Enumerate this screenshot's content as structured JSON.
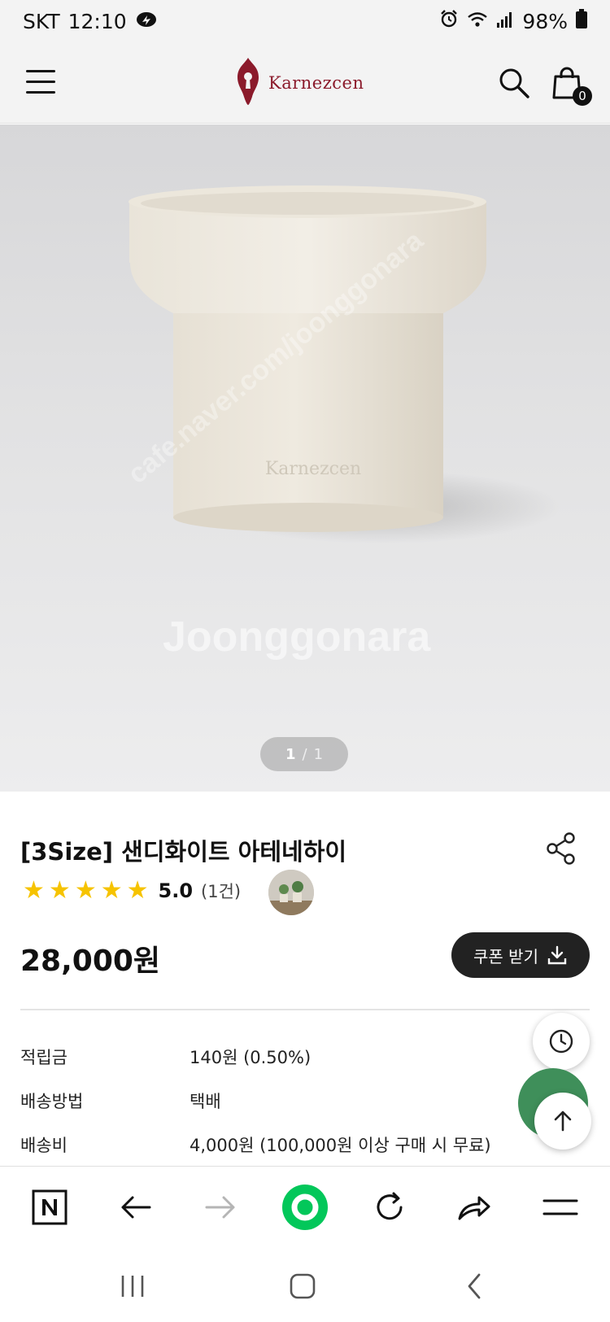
{
  "status_bar": {
    "carrier": "SKT",
    "time": "12:10",
    "battery": "98%"
  },
  "header": {
    "logo_text": "Karnezcen",
    "cart_count": "0"
  },
  "hero": {
    "product_emboss": "Karnezcen",
    "watermark": "Joonggonara",
    "watermark_diag": "cafe.naver.com/joonggonara",
    "slide_current": "1",
    "slide_separator": "/",
    "slide_total": "1"
  },
  "product": {
    "title": "[3Size] 샌디화이트 아테네하이",
    "rating_value": "5.0",
    "review_count": "(1건)",
    "stars": 5,
    "price": "28,000원",
    "coupon_label": "쿠폰 받기"
  },
  "info_rows": [
    {
      "label": "적립금",
      "value": "140원 (0.50%)"
    },
    {
      "label": "배송방법",
      "value": "택배"
    },
    {
      "label": "배송비",
      "value": "4,000원 (100,000원 이상 구매 시 무료)"
    }
  ],
  "colors": {
    "brand": "#8b1a2b",
    "star": "#f6c300",
    "naver_green": "#03c75a",
    "dark_button": "#222222"
  },
  "icons": {
    "menu": "hamburger-icon",
    "search": "search-icon",
    "cart": "shopping-bag-icon",
    "share": "share-icon",
    "download": "download-icon",
    "recent": "clock-icon",
    "scroll_top": "arrow-up-icon"
  }
}
